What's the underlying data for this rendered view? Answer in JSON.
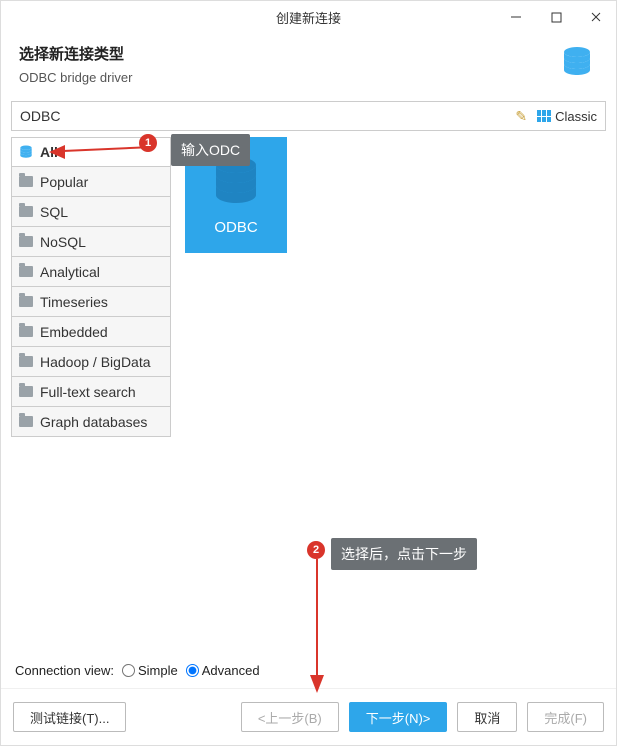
{
  "window": {
    "title": "创建新连接"
  },
  "header": {
    "heading": "选择新连接类型",
    "subheading": "ODBC bridge driver"
  },
  "search": {
    "value": "ODBC",
    "classic_label": "Classic"
  },
  "sidebar": {
    "items": [
      {
        "label": "All",
        "active": true,
        "icon": "stack"
      },
      {
        "label": "Popular",
        "active": false
      },
      {
        "label": "SQL",
        "active": false
      },
      {
        "label": "NoSQL",
        "active": false
      },
      {
        "label": "Analytical",
        "active": false
      },
      {
        "label": "Timeseries",
        "active": false
      },
      {
        "label": "Embedded",
        "active": false
      },
      {
        "label": "Hadoop / BigData",
        "active": false
      },
      {
        "label": "Full-text search",
        "active": false
      },
      {
        "label": "Graph databases",
        "active": false
      }
    ]
  },
  "drivers": {
    "tiles": [
      {
        "name": "ODBC"
      }
    ]
  },
  "connection_view": {
    "label": "Connection view:",
    "options": {
      "simple": "Simple",
      "advanced": "Advanced"
    },
    "selected": "advanced"
  },
  "footer": {
    "test": "测试链接(T)...",
    "back": "<上一步(B)",
    "next": "下一步(N)>",
    "cancel": "取消",
    "finish": "完成(F)"
  },
  "annotations": {
    "a1": {
      "num": "1",
      "text": "输入ODC"
    },
    "a2": {
      "num": "2",
      "text": "选择后，点击下一步"
    }
  }
}
